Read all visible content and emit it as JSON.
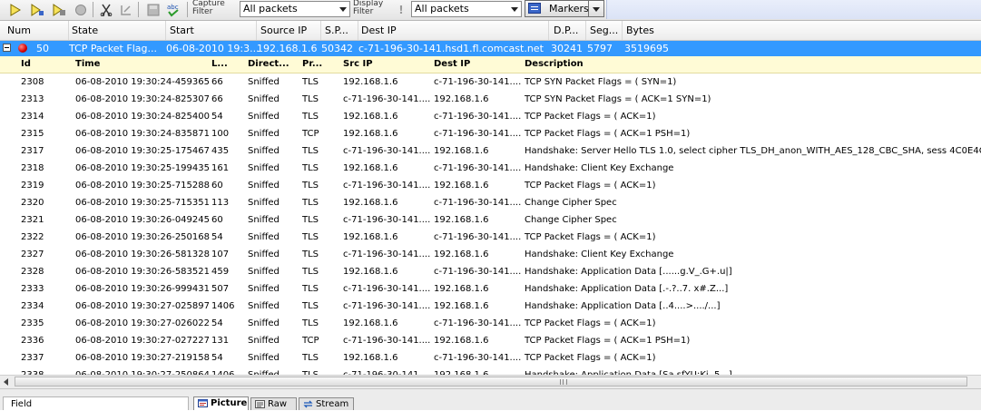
{
  "toolbar": {
    "capture_filter_label": "Capture\nFilter",
    "capture_filter_value": "All packets",
    "display_filter_label": "Display\nFilter",
    "display_filter_value": "All packets",
    "markers_label": "Markers",
    "icons": [
      "play-icon",
      "play-step-icon",
      "play-multi-icon",
      "stop-icon",
      "scissors-icon",
      "edit-icon",
      "save-disabled-icon",
      "abc-spellcheck-icon",
      "filter-warning-icon",
      "markers-icon"
    ]
  },
  "conversation_columns": [
    "Num",
    "State",
    "Start",
    "Source IP",
    "S.P...",
    "Dest IP",
    "D.P...",
    "Seg...",
    "Bytes"
  ],
  "selected_conversation": {
    "num": "50",
    "state": "TCP  Packet Flag...",
    "start": "06-08-2010 19:3...",
    "source_ip": "192.168.1.6",
    "source_port": "50342",
    "dest_ip": "c-71-196-30-141.hsd1.fl.comcast.net",
    "dest_port": "30241",
    "segments": "5797",
    "bytes": "3519695"
  },
  "packet_columns": [
    "Id",
    "Time",
    "L...",
    "Direct...",
    "Pr...",
    "Src IP",
    "Dest IP",
    "Description"
  ],
  "packets": [
    [
      "2308",
      "06-08-2010 19:30:24-459365",
      "66",
      "Sniffed",
      "TLS",
      "192.168.1.6",
      "c-71-196-30-141....",
      "TCP SYN Packet Flags = ( SYN=1)"
    ],
    [
      "2313",
      "06-08-2010 19:30:24-825307",
      "66",
      "Sniffed",
      "TLS",
      "c-71-196-30-141....",
      "192.168.1.6",
      "TCP SYN Packet Flags = ( ACK=1 SYN=1)"
    ],
    [
      "2314",
      "06-08-2010 19:30:24-825400",
      "54",
      "Sniffed",
      "TLS",
      "192.168.1.6",
      "c-71-196-30-141....",
      "TCP  Packet Flags = ( ACK=1)"
    ],
    [
      "2315",
      "06-08-2010 19:30:24-835871",
      "100",
      "Sniffed",
      "TCP",
      "192.168.1.6",
      "c-71-196-30-141....",
      "TCP  Packet Flags = ( ACK=1 PSH=1)"
    ],
    [
      "2317",
      "06-08-2010 19:30:25-175467",
      "435",
      "Sniffed",
      "TLS",
      "c-71-196-30-141....",
      "192.168.1.6",
      "Handshake: Server Hello TLS 1.0, select cipher TLS_DH_anon_WITH_AES_128_CBC_SHA, sess 4C0E4CFF..."
    ],
    [
      "2318",
      "06-08-2010 19:30:25-199435",
      "161",
      "Sniffed",
      "TLS",
      "192.168.1.6",
      "c-71-196-30-141....",
      "Handshake: Client Key Exchange"
    ],
    [
      "2319",
      "06-08-2010 19:30:25-715288",
      "60",
      "Sniffed",
      "TLS",
      "c-71-196-30-141....",
      "192.168.1.6",
      "TCP  Packet Flags = ( ACK=1)"
    ],
    [
      "2320",
      "06-08-2010 19:30:25-715351",
      "113",
      "Sniffed",
      "TLS",
      "192.168.1.6",
      "c-71-196-30-141....",
      "Change Cipher Spec"
    ],
    [
      "2321",
      "06-08-2010 19:30:26-049245",
      "60",
      "Sniffed",
      "TLS",
      "c-71-196-30-141....",
      "192.168.1.6",
      "Change Cipher Spec"
    ],
    [
      "2322",
      "06-08-2010 19:30:26-250168",
      "54",
      "Sniffed",
      "TLS",
      "192.168.1.6",
      "c-71-196-30-141....",
      "TCP  Packet Flags = ( ACK=1)"
    ],
    [
      "2327",
      "06-08-2010 19:30:26-581328",
      "107",
      "Sniffed",
      "TLS",
      "c-71-196-30-141....",
      "192.168.1.6",
      "Handshake: Client Key Exchange"
    ],
    [
      "2328",
      "06-08-2010 19:30:26-583521",
      "459",
      "Sniffed",
      "TLS",
      "192.168.1.6",
      "c-71-196-30-141....",
      "Handshake: Application Data [......g.V_.G+.u|]"
    ],
    [
      "2333",
      "06-08-2010 19:30:26-999431",
      "507",
      "Sniffed",
      "TLS",
      "c-71-196-30-141....",
      "192.168.1.6",
      "Handshake: Application Data [.-.?..7. x#.Z...]"
    ],
    [
      "2334",
      "06-08-2010 19:30:27-025897",
      "1406",
      "Sniffed",
      "TLS",
      "c-71-196-30-141....",
      "192.168.1.6",
      "Handshake: Application Data [..4....>..../...]"
    ],
    [
      "2335",
      "06-08-2010 19:30:27-026022",
      "54",
      "Sniffed",
      "TLS",
      "192.168.1.6",
      "c-71-196-30-141....",
      "TCP  Packet Flags = ( ACK=1)"
    ],
    [
      "2336",
      "06-08-2010 19:30:27-027227",
      "131",
      "Sniffed",
      "TCP",
      "c-71-196-30-141....",
      "192.168.1.6",
      "TCP  Packet Flags = ( ACK=1 PSH=1)"
    ],
    [
      "2337",
      "06-08-2010 19:30:27-219158",
      "54",
      "Sniffed",
      "TLS",
      "192.168.1.6",
      "c-71-196-30-141....",
      "TCP  Packet Flags = ( ACK=1)"
    ],
    [
      "2338",
      "06-08-2010 19:30:27-250864",
      "1406",
      "Sniffed",
      "TLS",
      "c-71-196-30-141....",
      "192.168.1.6",
      "Handshake: Application Data [Sa.sfYU;Ki..5...]"
    ]
  ],
  "bottom": {
    "field_label": "Field",
    "tabs": [
      {
        "label": "Picture",
        "active": true,
        "icon": "picture-icon"
      },
      {
        "label": "Raw",
        "active": false,
        "icon": "raw-data-icon"
      },
      {
        "label": "Stream",
        "active": false,
        "icon": "stream-arrows-icon"
      }
    ]
  }
}
